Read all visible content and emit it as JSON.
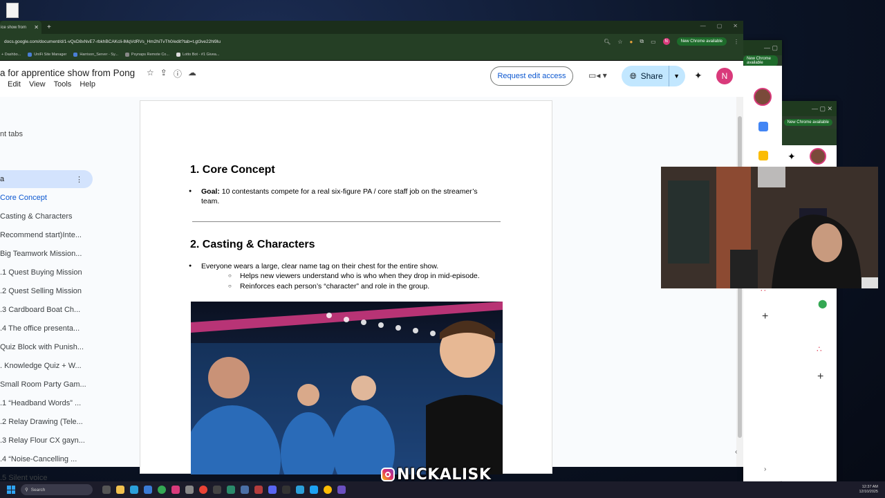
{
  "browser": {
    "tab_title": "ice show from",
    "url": "docs.google.com/document/d/1-vQxD8xNvE7-rbkhBCAKcli-lMqVdRVs_Hm2hiTvTh0/edit?tab=t.gt3ve22hl9lu",
    "new_chrome": "New Chrome available",
    "bookmarks": [
      "+ Dashbo...",
      "UniFi Site Manager",
      "Harrison_Server - Sy...",
      "Psynaps Remote Co...",
      "Lotto Bot - #1 Givea..."
    ]
  },
  "docs": {
    "title": "a for apprentice show from Pong",
    "menu": [
      "Edit",
      "View",
      "Tools",
      "Help"
    ],
    "request_edit": "Request edit access",
    "share": "Share",
    "user_initial": "N"
  },
  "outline": {
    "header": "nt tabs",
    "active_tab": "a",
    "items": [
      "Core Concept",
      "Casting & Characters",
      "Recommend start)Inte...",
      "Big Teamwork Mission...",
      ".1 Quest Buying Mission",
      ".2 Quest Selling Mission",
      ".3 Cardboard Boat Ch...",
      ".4 The office presenta...",
      "Quiz Block with Punish...",
      ". Knowledge Quiz + W...",
      "Small Room Party Gam...",
      ".1 “Headband Words” ...",
      ".2 Relay Drawing (Tele...",
      ".3 Relay Flour CX gayn...",
      ".4 “Noise-Cancelling ...",
      ".5 Silent voice"
    ]
  },
  "document": {
    "section1_title": "1. Core Concept",
    "goal_label": "Goal:",
    "goal_text": " 10 contestants compete for a real six-figure PA / core staff job on the streamer’s team.",
    "section2_title": "2. Casting & Characters",
    "bullet": "Everyone wears a large, clear name tag on their chest for the entire show.",
    "sub1": "Helps new viewers understand who is who when they drop in mid-episode.",
    "sub2": "Reinforces each person’s “character” and role in the group."
  },
  "taskbar": {
    "search_placeholder": "Search",
    "time": "12:37 AM",
    "date": "12/10/2025"
  },
  "watermark": "NICKALISK"
}
